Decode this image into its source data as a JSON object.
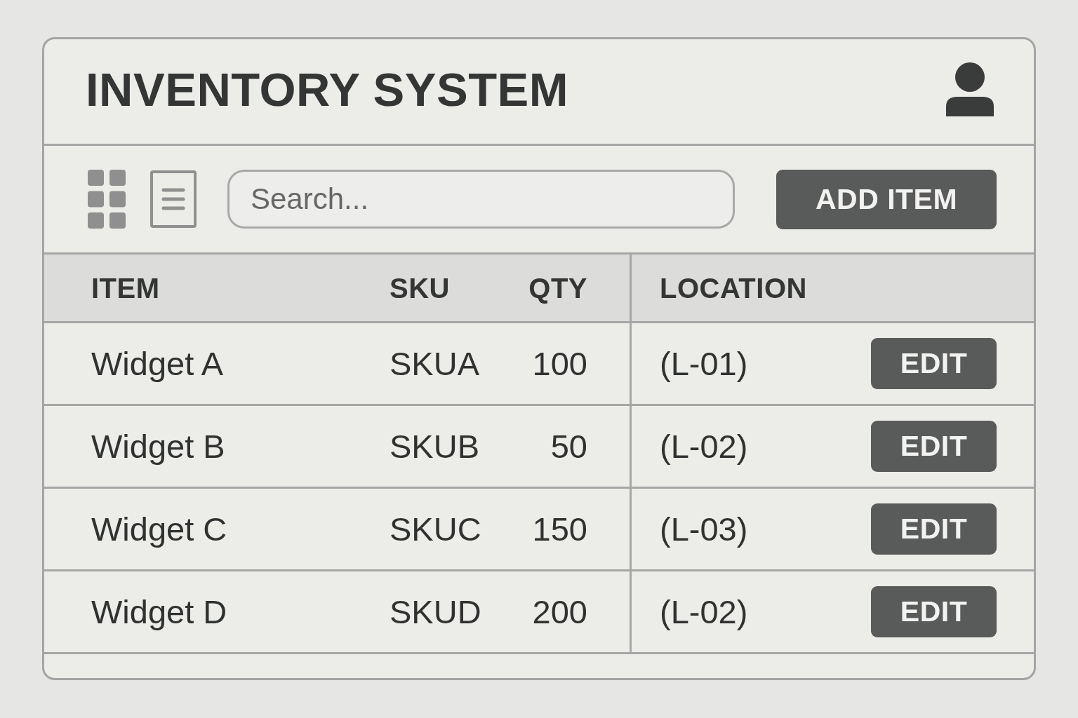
{
  "window": {
    "title": "INVENTORY SYSTEM"
  },
  "toolbar": {
    "search": {
      "placeholder": "Search..."
    },
    "add_button": "ADD ITEM"
  },
  "table": {
    "columns": [
      "ITEM",
      "SKU",
      "QTY",
      "LOCATION"
    ],
    "rows": [
      {
        "item": "Widget A",
        "sku": "SKUA",
        "qty": "100",
        "location": "(L-01)",
        "action": "EDIT"
      },
      {
        "item": "Widget B",
        "sku": "SKUB",
        "qty": "50",
        "location": "(L-02)",
        "action": "EDIT"
      },
      {
        "item": "Widget C",
        "sku": "SKUC",
        "qty": "150",
        "location": "(L-03)",
        "action": "EDIT"
      },
      {
        "item": "Widget D",
        "sku": "SKUD",
        "qty": "200",
        "location": "(L-02)",
        "action": "EDIT"
      }
    ]
  }
}
